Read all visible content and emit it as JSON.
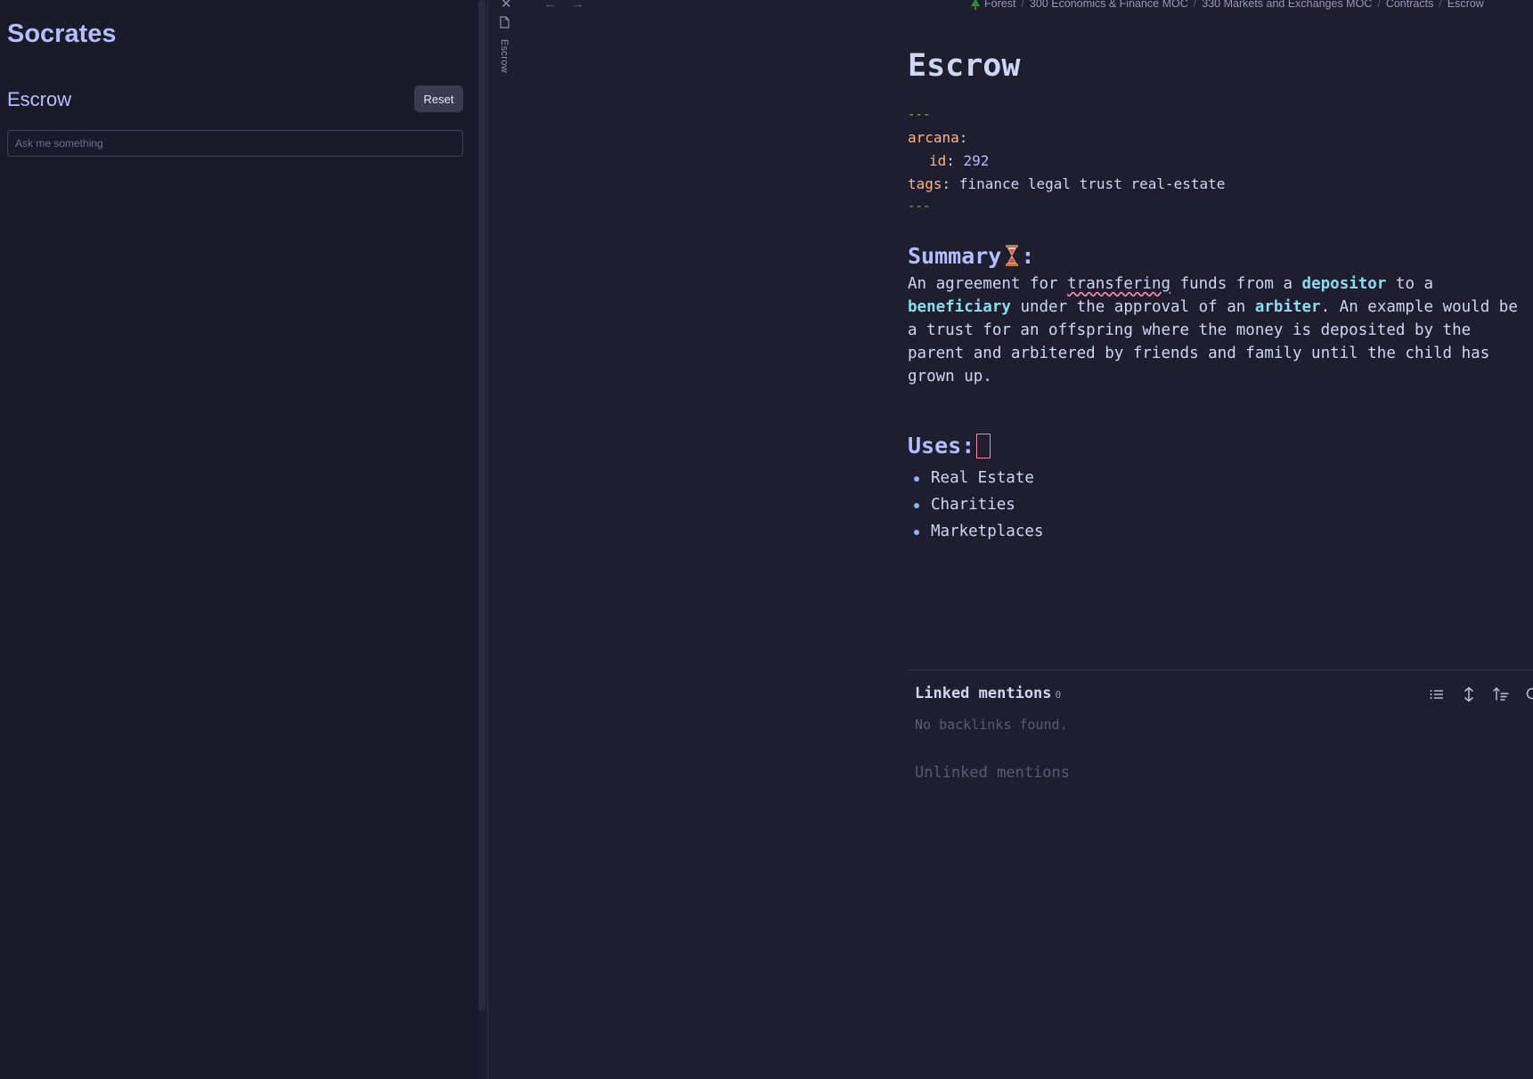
{
  "socrates": {
    "app_title": "Socrates",
    "note_title": "Escrow",
    "reset_label": "Reset",
    "ask_placeholder": "Ask me something"
  },
  "tab_strip": {
    "tab_label": "Escrow"
  },
  "breadcrumb": [
    "Forest",
    "300 Economics & Finance MOC",
    "330 Markets and Exchanges MOC",
    "Contracts",
    "Escrow"
  ],
  "note": {
    "title": "Escrow",
    "frontmatter": {
      "dash": "---",
      "arcana_key": "arcana",
      "id_key": "id",
      "id_value": "292",
      "tags_key": "tags",
      "tags_value": "finance legal trust real-estate"
    },
    "summary_heading": "Summary",
    "summary_icon": "hourglass-icon",
    "summary_colon": ":",
    "summary": {
      "p1": "An agreement for ",
      "misspelled": "transfering",
      "p2": " funds from a ",
      "depositor": "depositor",
      "p3": " to a ",
      "beneficiary": "beneficiary",
      "p4": " under the approval of an ",
      "arbiter": "arbiter",
      "p5": ". An example would be a trust for an offspring where the money is deposited by the parent and arbitered by friends and family until the child has grown up."
    },
    "uses_heading": "Uses:",
    "uses": [
      "Real Estate",
      "Charities",
      "Marketplaces"
    ]
  },
  "backlinks": {
    "linked_title": "Linked mentions",
    "linked_count": "0",
    "empty_text": "No backlinks found.",
    "unlinked_title": "Unlinked mentions"
  },
  "colors": {
    "background": "#1e1e2e",
    "panel": "#1a1a28",
    "accent": "#b4befe",
    "bold_link": "#89dceb",
    "frontmatter_key": "#fab387"
  }
}
